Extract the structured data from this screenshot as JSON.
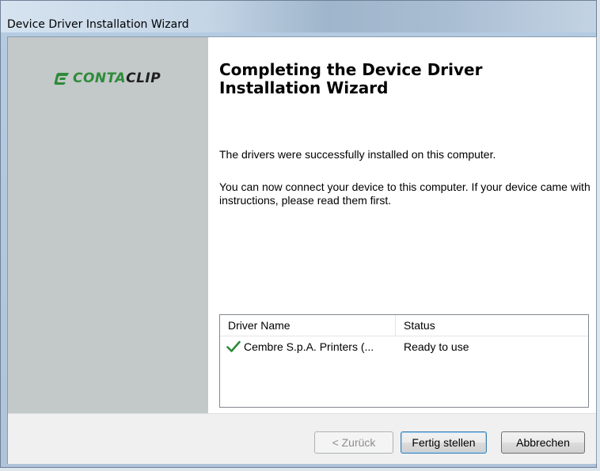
{
  "window": {
    "title": "Device Driver Installation Wizard"
  },
  "logo": {
    "text_a": "CONTA",
    "text_b": "CLIP",
    "icon": "contaclip-logo-mark",
    "color_a": "#2e8b3a",
    "color_b": "#1f1f1f"
  },
  "main": {
    "heading": "Completing the Device Driver Installation Wizard",
    "paragraph1": "The drivers were successfully installed on this computer.",
    "paragraph2": "You can now connect your device to this computer. If your device came with instructions, please read them first."
  },
  "driver_list": {
    "columns": [
      "Driver Name",
      "Status"
    ],
    "rows": [
      {
        "icon": "green-checkmark-icon",
        "name": "Cembre S.p.A. Printers (...",
        "status": "Ready to use"
      }
    ]
  },
  "buttons": {
    "back": "< Zurück",
    "finish": "Fertig stellen",
    "cancel": "Abbrechen"
  },
  "colors": {
    "side_panel": "#c3c8c8",
    "check": "#2e8b3a"
  }
}
